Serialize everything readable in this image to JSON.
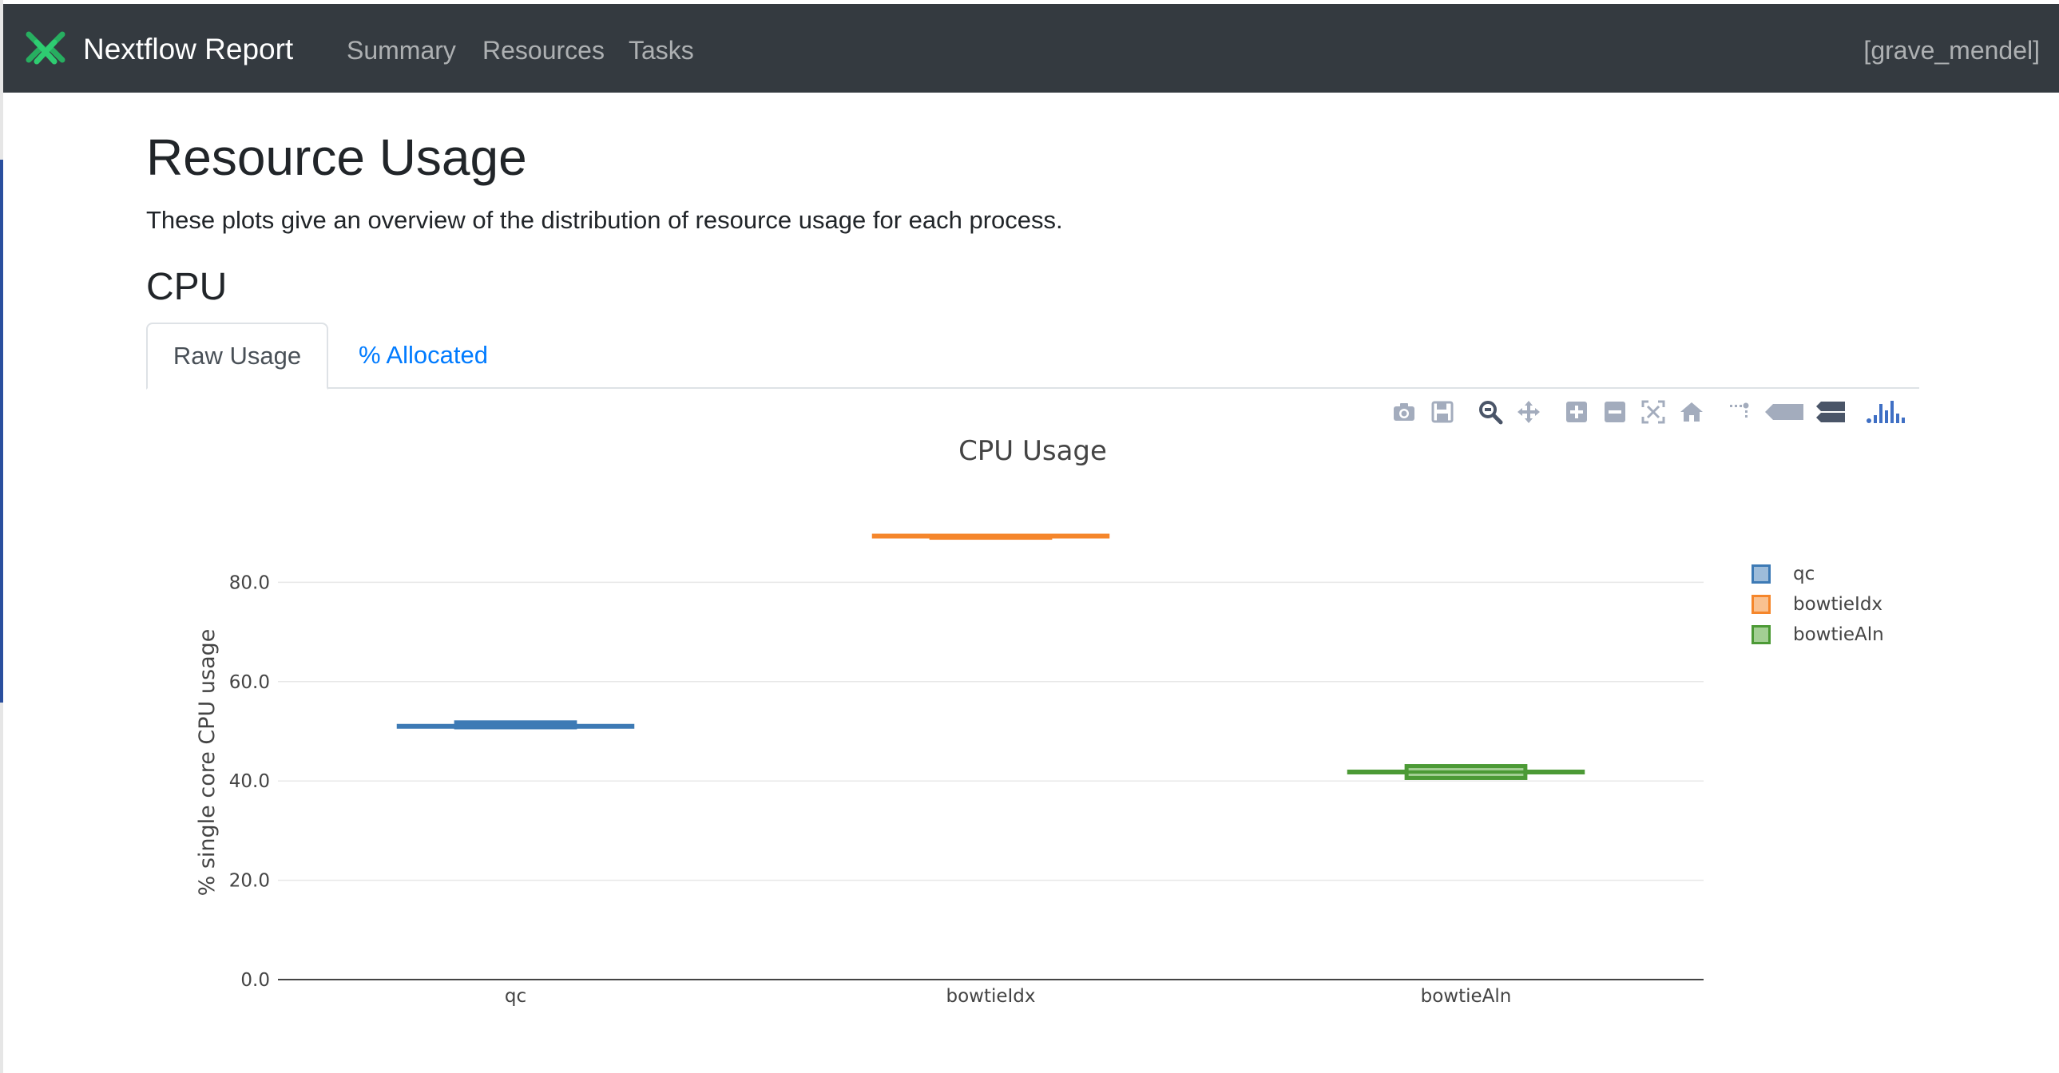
{
  "navbar": {
    "brand": "Nextflow Report",
    "links": [
      "Summary",
      "Resources",
      "Tasks"
    ],
    "run_name": "[grave_mendel]"
  },
  "page": {
    "title": "Resource Usage",
    "lead": "These plots give an overview of the distribution of resource usage for each process.",
    "section": "CPU"
  },
  "tabs": {
    "active": "Raw Usage",
    "inactive": "% Allocated"
  },
  "modebar": {
    "icons": [
      "camera-icon",
      "save-icon",
      "zoom-icon",
      "pan-icon",
      "zoom-in-icon",
      "zoom-out-icon",
      "autoscale-icon",
      "reset-axes-icon",
      "spike-lines-icon",
      "hover-closest-icon",
      "hover-compare-icon",
      "plotly-logo-icon"
    ]
  },
  "chart_data": {
    "type": "box",
    "title": "CPU Usage",
    "xlabel": "",
    "ylabel": "% single core CPU usage",
    "ylim": [
      0,
      100
    ],
    "yticks": [
      "0.0",
      "20.0",
      "40.0",
      "60.0",
      "80.0"
    ],
    "grid": true,
    "legend_position": "right",
    "categories": [
      "qc",
      "bowtieIdx",
      "bowtieAln"
    ],
    "series": [
      {
        "name": "qc",
        "color": "#3d7ab5",
        "fill": "#9dbcda",
        "box": {
          "q1": 50.8,
          "median": 51.2,
          "q3": 51.8,
          "whisker_low": 50.8,
          "whisker_high": 51.2
        }
      },
      {
        "name": "bowtieIdx",
        "color": "#f5862b",
        "fill": "#f9c190",
        "box": {
          "q1": 89.3,
          "median": 89.3,
          "q3": 89.3,
          "whisker_low": 89.3,
          "whisker_high": 89.3
        }
      },
      {
        "name": "bowtieAln",
        "color": "#4c9a36",
        "fill": "#a3cf94",
        "box": {
          "q1": 40.6,
          "median": 41.8,
          "q3": 43.0,
          "whisker_low": 41.2,
          "whisker_high": 42.4
        }
      }
    ]
  }
}
